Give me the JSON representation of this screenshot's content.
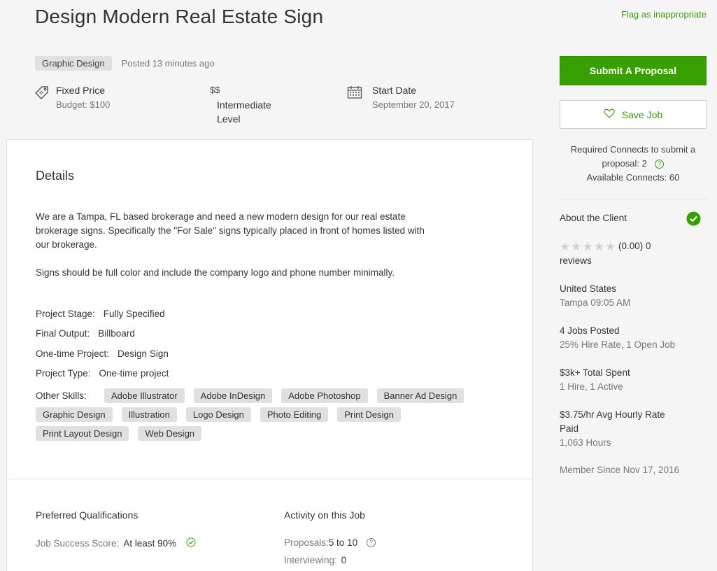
{
  "header": {
    "title": "Design Modern Real Estate Sign",
    "flag_label": "Flag as inappropriate",
    "category": "Graphic Design",
    "posted": "Posted 13 minutes ago"
  },
  "facts": {
    "price_type": "Fixed Price",
    "budget": "Budget: $100",
    "level_symbol": "$$",
    "level_line1": "Intermediate",
    "level_line2": "Level",
    "start_label": "Start Date",
    "start_value": "September 20, 2017"
  },
  "details": {
    "heading": "Details",
    "para1_line1": "We are a Tampa, FL based brokerage and need a new modern design for our real estate",
    "para1_line2": "brokerage signs. Specifically the \"For Sale\" signs typically placed in front of homes listed with",
    "para1_line3": "our brokerage.",
    "para2": "Signs should be full color and include the company logo and phone number minimally.",
    "fields": [
      {
        "k": "Project Stage:",
        "v": "Fully Specified"
      },
      {
        "k": "Final Output:",
        "v": "Billboard"
      },
      {
        "k": "One-time Project:",
        "v": "Design Sign"
      },
      {
        "k": "Project Type:",
        "v": "One-time project"
      }
    ],
    "skills_label": "Other Skills:",
    "skills": [
      "Adobe Illustrator",
      "Adobe InDesign",
      "Adobe Photoshop",
      "Banner Ad Design",
      "Graphic Design",
      "Illustration",
      "Logo Design",
      "Photo Editing",
      "Print Design",
      "Print Layout Design",
      "Web Design"
    ]
  },
  "qualifications": {
    "heading": "Preferred Qualifications",
    "jss_label": "Job Success Score:",
    "jss_value": "At least 90%"
  },
  "activity": {
    "heading": "Activity on this Job",
    "proposals_label": "Proposals:",
    "proposals_value": "5 to 10",
    "interviewing_label": "Interviewing:",
    "interviewing_value": "0"
  },
  "sidebar": {
    "submit_label": "Submit A Proposal",
    "save_label": "Save Job",
    "connects_line1": "Required Connects to submit a",
    "connects_line2": "proposal: 2",
    "connects_line3": "Available Connects: 60",
    "about_label": "About the Client",
    "rating_text": "(0.00) 0",
    "reviews_text": "reviews",
    "country": "United States",
    "city_time": "Tampa 09:05 AM",
    "jobs_posted": "4 Jobs Posted",
    "jobs_sub": "25% Hire Rate, 1 Open Job",
    "spent": "$3k+ Total Spent",
    "spent_sub": "1 Hire, 1 Active",
    "rate_line1": "$3.75/hr Avg Hourly Rate",
    "rate_line2": "Paid",
    "hours": "1,063 Hours",
    "member_since": "Member Since Nov 17, 2016",
    "rating_value": 0,
    "rating_max": 5
  },
  "colors": {
    "accent": "#37a000",
    "tag_bg": "#e0e0e0",
    "page_bg": "#f5f5f5"
  }
}
